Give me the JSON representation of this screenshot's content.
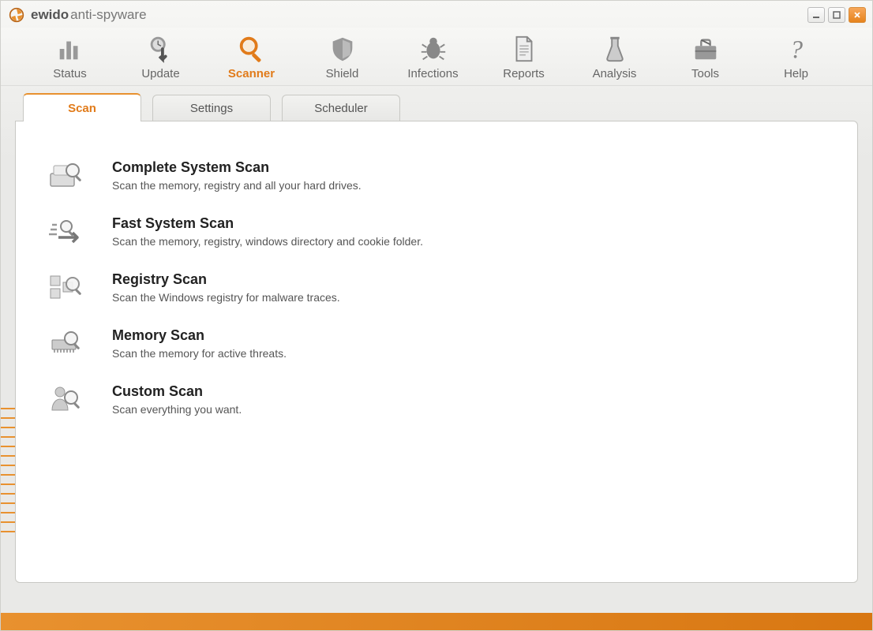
{
  "app": {
    "title_bold": "ewido",
    "title_light": "anti-spyware"
  },
  "toolbar": {
    "items": [
      {
        "label": "Status",
        "icon": "bars-icon"
      },
      {
        "label": "Update",
        "icon": "clock-arrow-icon"
      },
      {
        "label": "Scanner",
        "icon": "magnifier-icon",
        "active": true
      },
      {
        "label": "Shield",
        "icon": "shield-icon"
      },
      {
        "label": "Infections",
        "icon": "bug-icon"
      },
      {
        "label": "Reports",
        "icon": "document-icon"
      },
      {
        "label": "Analysis",
        "icon": "beaker-icon"
      },
      {
        "label": "Tools",
        "icon": "toolbox-icon"
      },
      {
        "label": "Help",
        "icon": "question-icon"
      }
    ]
  },
  "tabs": {
    "items": [
      {
        "label": "Scan",
        "active": true
      },
      {
        "label": "Settings"
      },
      {
        "label": "Scheduler"
      }
    ]
  },
  "scans": [
    {
      "title": "Complete System Scan",
      "desc": "Scan the memory, registry and all your hard drives.",
      "icon": "drive-magnify-icon"
    },
    {
      "title": "Fast System Scan",
      "desc": "Scan the memory, registry, windows directory and cookie folder.",
      "icon": "fast-arrow-icon"
    },
    {
      "title": "Registry Scan",
      "desc": "Scan the Windows registry for malware traces.",
      "icon": "registry-magnify-icon"
    },
    {
      "title": "Memory Scan",
      "desc": "Scan the memory for active threats.",
      "icon": "chip-magnify-icon"
    },
    {
      "title": "Custom Scan",
      "desc": "Scan everything you want.",
      "icon": "person-magnify-icon"
    }
  ]
}
